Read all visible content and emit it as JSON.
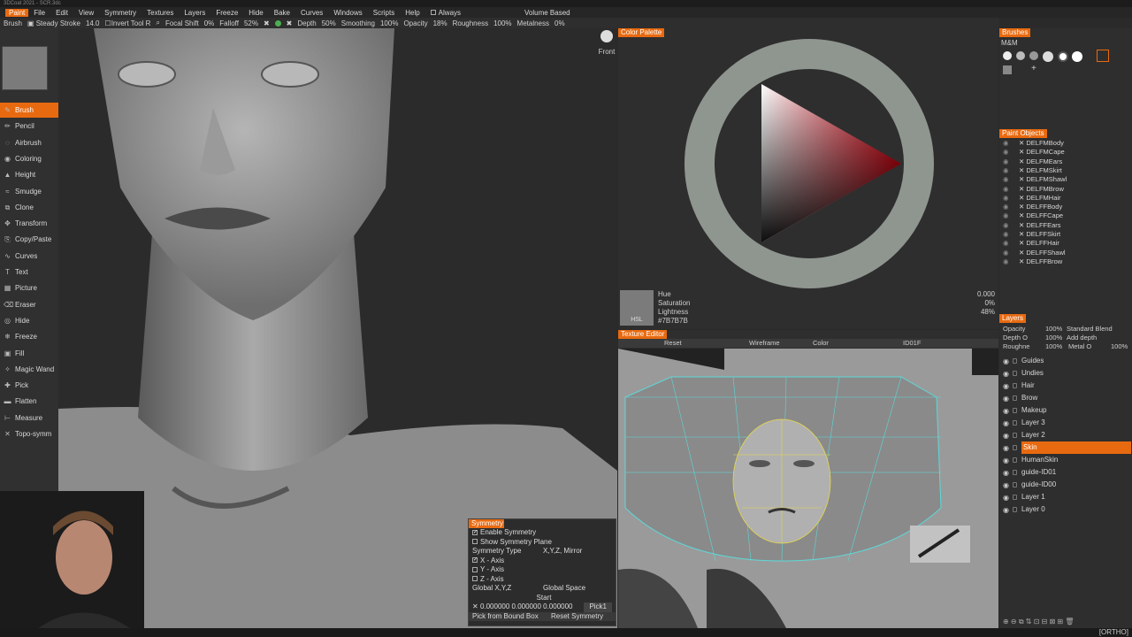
{
  "window": {
    "title": "3DCoat 2021 - SCR.3dc"
  },
  "menu": {
    "app": "Paint",
    "items": [
      "File",
      "Edit",
      "View",
      "Symmetry",
      "Textures",
      "Layers",
      "Freeze",
      "Hide",
      "Bake",
      "Curves",
      "Windows",
      "Scripts",
      "Help"
    ],
    "always": "Always",
    "volume": "Volume Based"
  },
  "toolbar": {
    "brush": "Brush",
    "steady": "Steady Stroke",
    "steady_val": "14.0",
    "invert": "Invert Tool R",
    "focal": "Focal Shift",
    "focal_val": "0%",
    "falloff": "Falloff",
    "falloff_val": "52%",
    "depth": "Depth",
    "depth_val": "50%",
    "smoothing": "Smoothing",
    "smoothing_val": "100%",
    "opacity": "Opacity",
    "opacity_val": "18%",
    "roughness": "Roughness",
    "roughness_val": "100%",
    "metalness": "Metalness",
    "metalness_val": "0%"
  },
  "tools": [
    "Brush",
    "Pencil",
    "Airbrush",
    "Coloring",
    "Height",
    "Smudge",
    "Clone",
    "Transform",
    "Copy/Paste",
    "Curves",
    "Text",
    "Picture",
    "Eraser",
    "Hide",
    "Freeze",
    "Fill",
    "Magic Wand",
    "Pick",
    "Flatten",
    "Measure",
    "Topo-symm"
  ],
  "view": {
    "label": "Front"
  },
  "symmetry": {
    "title": "Symmetry",
    "enable": "Enable Symmetry",
    "show_plane": "Show Symmetry Plane",
    "type_label": "Symmetry Type",
    "type_val": "X,Y,Z, Mirror",
    "x": "X - Axis",
    "y": "Y - Axis",
    "z": "Z - Axis",
    "global": "Global X,Y,Z",
    "space": "Global Space",
    "start": "Start",
    "coords": "0.000000  0.000000  0.000000",
    "pick": "Pick1",
    "pick_bound": "Pick from Bound Box",
    "reset": "Reset Symmetry"
  },
  "palette": {
    "title": "Color Palette",
    "hue": "Hue",
    "hue_val": "0.000",
    "sat": "Saturation",
    "sat_val": "0%",
    "light": "Lightness",
    "light_val": "48%",
    "mode": "HSL",
    "hex": "#7B7B7B",
    "swatch": "#7b7b7b"
  },
  "texture_editor": {
    "title": "Texture Editor",
    "reset": "Reset",
    "wireframe": "Wireframe",
    "color": "Color",
    "id": "ID01F"
  },
  "brushes": {
    "title": "Brushes",
    "set": "M&M"
  },
  "paint_objects": {
    "title": "Paint Objects",
    "items": [
      "DELFMBody",
      "DELFMCape",
      "DELFMEars",
      "DELFMSkirt",
      "DELFMShawl",
      "DELFMBrow",
      "DELFMHair",
      "DELFFBody",
      "DELFFCape",
      "DELFFEars",
      "DELFFSkirt",
      "DELFFHair",
      "DELFFShawl",
      "DELFFBrow"
    ]
  },
  "layers": {
    "title": "Layers",
    "opacity": "Opacity",
    "opacity_val": "100%",
    "blend": "Standard Blend",
    "depth": "Depth O",
    "depth_val": "100%",
    "add_depth": "Add depth",
    "rough": "Roughne",
    "rough_val": "100%",
    "metal": "Metal O",
    "metal_val": "100%",
    "items": [
      "Guides",
      "Undies",
      "Hair",
      "Brow",
      "Makeup",
      "Layer 3",
      "Layer 2",
      "Skin",
      "HumanSkin",
      "guide-ID01",
      "guide-ID00",
      "Layer 1",
      "Layer 0"
    ],
    "selected": "Skin"
  },
  "status": {
    "ortho": "[ORTHO]"
  },
  "colors": {
    "accent": "#e86a10"
  }
}
